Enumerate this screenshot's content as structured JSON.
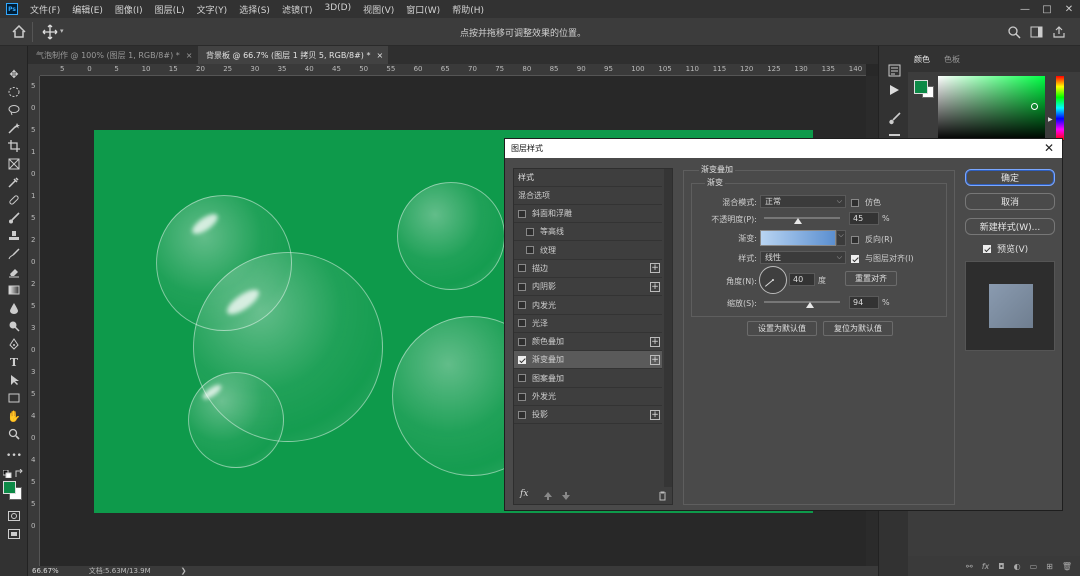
{
  "app": {
    "logo": "Ps"
  },
  "menu": [
    "文件(F)",
    "编辑(E)",
    "图像(I)",
    "图层(L)",
    "文字(Y)",
    "选择(S)",
    "滤镜(T)",
    "3D(D)",
    "视图(V)",
    "窗口(W)",
    "帮助(H)"
  ],
  "window_controls": {
    "minimize": "—",
    "maximize": "□",
    "close": "✕"
  },
  "options_bar": {
    "hint": "点按并拖移可调整效果的位置。"
  },
  "doc_tabs": [
    {
      "label": "气泡制作 @ 100% (图层 1, RGB/8#) *",
      "close": "×"
    },
    {
      "label": "背景板 @ 66.7% (图层 1 拷贝 5, RGB/8#) *",
      "close": "×"
    }
  ],
  "ruler_h": [
    "5",
    "0",
    "5",
    "10",
    "15",
    "20",
    "25",
    "30",
    "35",
    "40",
    "45",
    "50",
    "55",
    "60",
    "65",
    "70",
    "75",
    "80",
    "85",
    "90",
    "95",
    "100",
    "105",
    "110",
    "115",
    "120",
    "125",
    "130",
    "135",
    "140"
  ],
  "ruler_v": [
    "5",
    "0",
    "5",
    "1",
    "0",
    "1",
    "5",
    "2",
    "0",
    "2",
    "5",
    "3",
    "0",
    "3",
    "5",
    "4",
    "0",
    "4",
    "5",
    "5",
    "0"
  ],
  "status": {
    "zoom": "66.67%",
    "doc": "文档:5.63M/13.9M",
    "arrow": "❯"
  },
  "panel": {
    "tab_color": "颜色",
    "tab_swatch": "色板"
  },
  "colors": {
    "canvas_green": "#0e9a4b",
    "foreground": "#0d8a47",
    "background": "#ffffff"
  },
  "dialog": {
    "title": "图层样式",
    "close": "✕",
    "style_list": {
      "header": "样式",
      "blend": "混合选项",
      "items": [
        {
          "label": "斜面和浮雕",
          "checked": false,
          "plus": false,
          "indent": false
        },
        {
          "label": "等高线",
          "checked": false,
          "plus": false,
          "indent": true
        },
        {
          "label": "纹理",
          "checked": false,
          "plus": false,
          "indent": true
        },
        {
          "label": "描边",
          "checked": false,
          "plus": true,
          "indent": false
        },
        {
          "label": "内阴影",
          "checked": false,
          "plus": true,
          "indent": false
        },
        {
          "label": "内发光",
          "checked": false,
          "plus": false,
          "indent": false
        },
        {
          "label": "光泽",
          "checked": false,
          "plus": false,
          "indent": false
        },
        {
          "label": "颜色叠加",
          "checked": false,
          "plus": true,
          "indent": false
        },
        {
          "label": "渐变叠加",
          "checked": true,
          "plus": true,
          "indent": false,
          "selected": true
        },
        {
          "label": "图案叠加",
          "checked": false,
          "plus": false,
          "indent": false
        },
        {
          "label": "外发光",
          "checked": false,
          "plus": false,
          "indent": false
        },
        {
          "label": "投影",
          "checked": false,
          "plus": true,
          "indent": false
        }
      ],
      "fx": "fx",
      "plus_sign": "+"
    },
    "gradient_overlay": {
      "section_title": "渐变叠加",
      "group_title": "渐变",
      "blend_mode_label": "混合模式:",
      "blend_mode_value": "正常",
      "dither_label": "仿色",
      "dither_checked": false,
      "opacity_label": "不透明度(P):",
      "opacity_value": "45",
      "opacity_unit": "%",
      "gradient_label": "渐变:",
      "reverse_label": "反向(R)",
      "reverse_checked": false,
      "style_label": "样式:",
      "style_value": "线性",
      "align_label": "与图层对齐(I)",
      "align_checked": true,
      "angle_label": "角度(N):",
      "angle_value": "40",
      "angle_unit": "度",
      "reset_align": "重置对齐",
      "scale_label": "缩放(S):",
      "scale_value": "94",
      "scale_unit": "%",
      "set_default": "设置为默认值",
      "reset_default": "复位为默认值",
      "gradient_colors": [
        "#b8d4f2",
        "#5b8fd0"
      ]
    },
    "buttons": {
      "ok": "确定",
      "cancel": "取消",
      "new_style": "新建样式(W)...",
      "preview": "预览(V)",
      "preview_checked": true
    },
    "preview_swatch_colors": [
      "#6f7e90",
      "#8a9bb0"
    ]
  }
}
